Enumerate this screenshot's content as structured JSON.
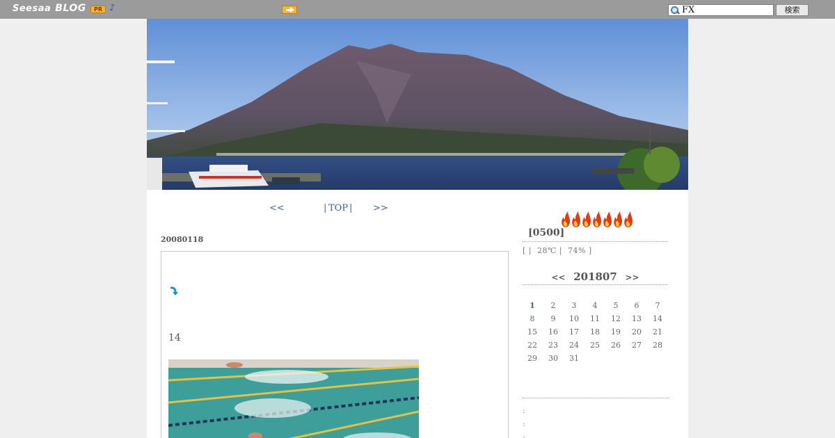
{
  "topbar": {
    "logo_text": "Seesaa",
    "logo_sub": "BLOG",
    "pr_label": "PR",
    "music_icon": "♪",
    "arrow_icon": "arrow-right-icon",
    "search_value": "FX",
    "search_button": "検索"
  },
  "nav": {
    "prev": "<<",
    "sep1": "|",
    "top": "TOP",
    "sep2": "|",
    "next": ">>"
  },
  "post": {
    "date": "20080118",
    "number": "14"
  },
  "sidebar": {
    "access_title": "[0500]",
    "weather": "[ |  28℃ |  74% ]",
    "calendar": {
      "prev": "<<",
      "month": "201807",
      "next": ">>",
      "today": "1",
      "weeks": [
        [
          "1",
          "2",
          "3",
          "4",
          "5",
          "6",
          "7"
        ],
        [
          "8",
          "9",
          "10",
          "11",
          "12",
          "13",
          "14"
        ],
        [
          "15",
          "16",
          "17",
          "18",
          "19",
          "20",
          "21"
        ],
        [
          "22",
          "23",
          "24",
          "25",
          "26",
          "27",
          "28"
        ],
        [
          "29",
          "30",
          "31",
          "",
          "",
          "",
          ""
        ]
      ]
    },
    "colon_lines": [
      ":",
      ":",
      ":"
    ]
  },
  "colors": {
    "topbar": "#9b9b9b",
    "link": "#3a62a6",
    "background": "#efefef",
    "accent_orange": "#f3b33d"
  }
}
